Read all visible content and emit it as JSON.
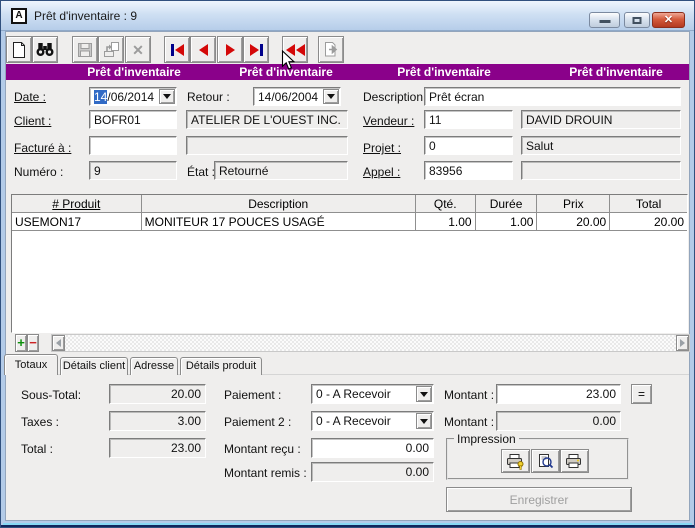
{
  "window": {
    "title": "Prêt d'inventaire : 9",
    "icon_letter": "A"
  },
  "banner": {
    "label": "Prêt d'inventaire",
    "color": "#8A018A"
  },
  "icons": {
    "toolbar": [
      "new-record-icon",
      "find-binoculars-icon",
      "save-icon",
      "transfer-icon",
      "delete-icon",
      "nav-first-icon",
      "nav-previous-icon",
      "nav-next-icon",
      "nav-last-icon",
      "nav-rewind-icon",
      "export-icon"
    ],
    "impression": [
      "print-setup-icon",
      "print-preview-icon",
      "print-icon"
    ],
    "colors": {
      "nav_arrow": "#d40808",
      "nav_bar": "#00008b",
      "add": "#0a8f0a",
      "remove": "#cc2222",
      "selection": "#316ac5"
    }
  },
  "form": {
    "date_label": "Date :",
    "date_selected": "14",
    "date_rest": "/06/2014",
    "retour_label": "Retour :",
    "retour_value": "14/06/2004",
    "client_label": "Client :",
    "client_code": "BOFR01",
    "client_name": "ATELIER DE L'OUEST INC.",
    "facture_label": "Facturé à :",
    "facture_code": "",
    "facture_name": "",
    "numero_label": "Numéro :",
    "numero_value": "9",
    "etat_label": "État :",
    "etat_value": "Retourné",
    "description_label": "Description:",
    "description_value": "Prêt écran",
    "vendeur_label": "Vendeur :",
    "vendeur_code": "11",
    "vendeur_name": "DAVID DROUIN",
    "projet_label": "Projet :",
    "projet_code": "0",
    "projet_name": "Salut",
    "appel_label": "Appel :",
    "appel_value": "83956",
    "appel_name": ""
  },
  "table": {
    "headers": [
      "# Produit",
      "Description",
      "Qté.",
      "Durée",
      "Prix",
      "Total"
    ],
    "rows": [
      {
        "produit": "USEMON17",
        "description": "MONITEUR 17 POUCES USAGÉ",
        "qte": "1.00",
        "duree": "1.00",
        "prix": "20.00",
        "total": "20.00"
      }
    ]
  },
  "row_tools": {
    "add_label": "+",
    "remove_label": "−"
  },
  "tabs": {
    "active": "Totaux",
    "items": [
      "Totaux",
      "Détails client",
      "Adresse",
      "Détails produit"
    ]
  },
  "totals": {
    "sous_total_label": "Sous-Total:",
    "sous_total": "20.00",
    "taxes_label": "Taxes :",
    "taxes": "3.00",
    "total_label": "Total :",
    "total": "23.00"
  },
  "payment": {
    "paiement_label": "Paiement :",
    "paiement_value": "0 - A Recevoir",
    "paiement2_label": "Paiement 2 :",
    "paiement2_value": "0 - A Recevoir",
    "recu_label": "Montant reçu :",
    "recu_value": "0.00",
    "remis_label": "Montant remis :",
    "remis_value": "0.00"
  },
  "amounts": {
    "montant_label": "Montant :",
    "montant_value": "23.00",
    "equals_label": "=",
    "montant2_label": "Montant :",
    "montant2_value": "0.00"
  },
  "impression": {
    "group_label": "Impression"
  },
  "actions": {
    "save_label": "Enregistrer"
  }
}
